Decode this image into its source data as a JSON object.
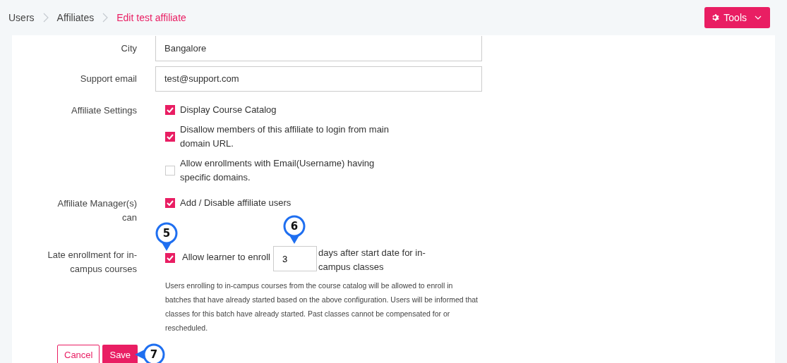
{
  "breadcrumb": [
    {
      "label": "Users",
      "current": false
    },
    {
      "label": "Affiliates",
      "current": false
    },
    {
      "label": "Edit test affiliate",
      "current": true
    }
  ],
  "tools_button": {
    "label": "Tools"
  },
  "fields": [
    {
      "label": "City",
      "value": "Bangalore"
    },
    {
      "label": "Support email",
      "value": "test@support.com"
    }
  ],
  "settings_groups": [
    {
      "label": "Affiliate Settings",
      "options": [
        {
          "text": "Display Course Catalog",
          "checked": true
        },
        {
          "text": "Disallow members of this affiliate to login from main domain URL.",
          "checked": true
        },
        {
          "text": "Allow enrollments with Email(Username) having specific domains.",
          "checked": false
        }
      ]
    },
    {
      "label": "Affiliate Manager(s) can",
      "options": [
        {
          "text": "Add / Disable affiliate users",
          "checked": true
        }
      ]
    }
  ],
  "late_enrollment": {
    "label": "Late enrollment for in-campus courses",
    "checked": true,
    "checkbox_callout": "5",
    "before": "Allow learner to enroll",
    "days": "3",
    "days_callout": "6",
    "after": "days after start date for in-campus classes",
    "help": "Users enrolling to in-campus courses from the course catalog will be allowed to enroll in batches that have already started based on the above configuration. Users will be informed that classes for this batch have already started. Past classes cannot be compensated for or rescheduled."
  },
  "actions": {
    "cancel": "Cancel",
    "save": "Save",
    "save_callout": "7"
  }
}
